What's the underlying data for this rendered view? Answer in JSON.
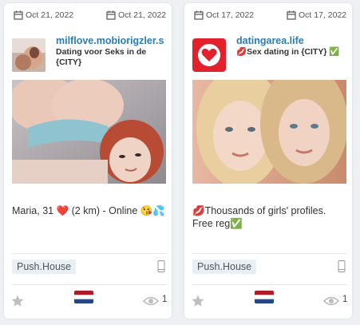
{
  "colors": {
    "accent": "#2b7cb3",
    "tag_bg": "#e7f0f5",
    "card_bg": "#ffffff",
    "page_bg": "#eef0f3"
  },
  "cards": [
    {
      "date_start": "Oct 21, 2022",
      "date_end": "Oct 21, 2022",
      "domain": "milflove.mobiorigzler.s",
      "subtitle": "Dating voor Seks in de {CITY}",
      "description": "Maria, 31 ❤️ (2 km) - Online 😘💦",
      "network": "Push.House",
      "views": "1",
      "device_icon": "mobile-phone-icon",
      "country_flag": "netherlands-flag-icon"
    },
    {
      "date_start": "Oct 17, 2022",
      "date_end": "Oct 17, 2022",
      "domain": "datingarea.life",
      "subtitle": "💋Sex dating in {CITY} ✅",
      "description": "💋Thousands of girls' profiles. Free reg✅",
      "network": "Push.House",
      "views": "1",
      "device_icon": "mobile-phone-icon",
      "country_flag": "netherlands-flag-icon"
    }
  ]
}
